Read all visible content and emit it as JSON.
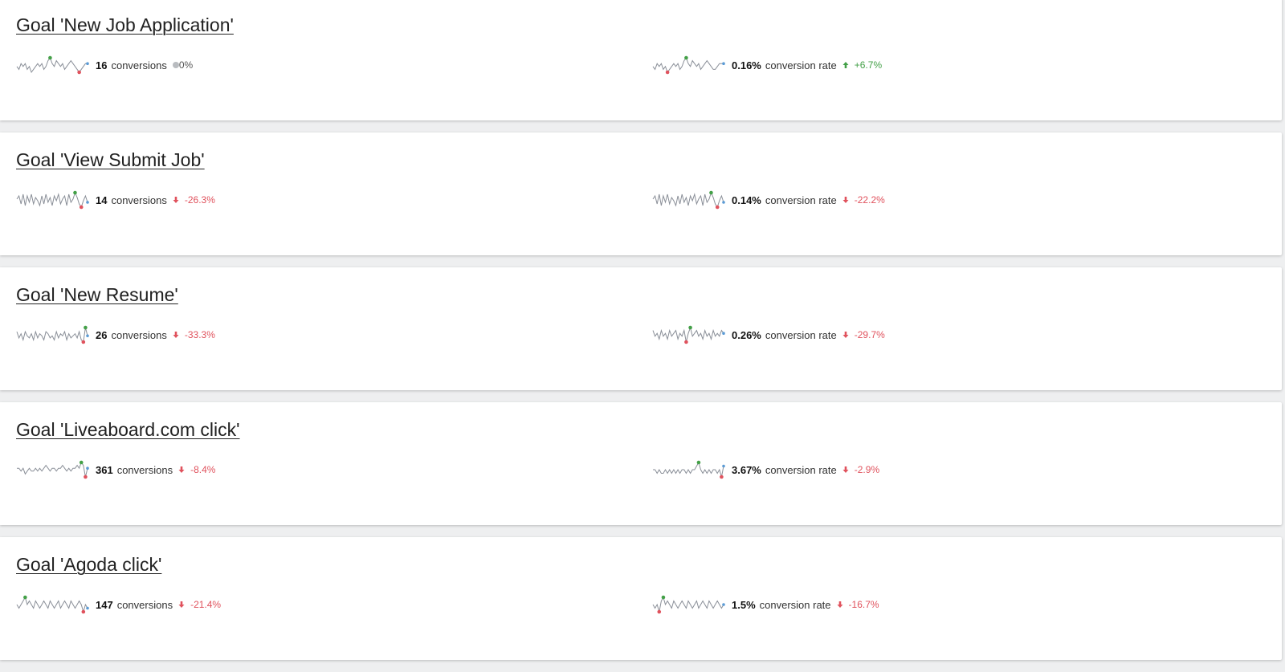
{
  "colors": {
    "up": "#43a047",
    "down": "#e0525d",
    "neutral": "#b9bcc0",
    "sparkline": "#8a8f98",
    "spark_max": "#43a047",
    "spark_min": "#e0525d",
    "spark_last": "#5b9bd5"
  },
  "goals": [
    {
      "title": "Goal 'New Job Application'",
      "conversions": {
        "value": "16",
        "label": "conversions",
        "trend": "0%",
        "direction": "neutral",
        "sparkline": [
          5,
          4,
          6,
          5,
          6,
          4,
          5,
          3,
          4,
          5,
          6,
          5,
          6,
          4,
          5,
          7,
          8,
          6,
          5,
          7,
          6,
          5,
          6,
          4,
          5,
          6,
          7,
          6,
          5,
          4,
          3,
          4,
          5,
          6,
          6
        ]
      },
      "rate": {
        "value": "0.16%",
        "label": "conversion rate",
        "trend": "+6.7%",
        "direction": "up",
        "sparkline": [
          5,
          4,
          6,
          5,
          6,
          4,
          5,
          3,
          4,
          5,
          6,
          5,
          6,
          4,
          5,
          7,
          8,
          6,
          5,
          7,
          6,
          5,
          6,
          4,
          5,
          6,
          7,
          6,
          5,
          4,
          4,
          5,
          6,
          6,
          6
        ]
      }
    },
    {
      "title": "Goal 'View Submit Job'",
      "conversions": {
        "value": "14",
        "label": "conversions",
        "trend": "-26.3%",
        "direction": "down",
        "sparkline": [
          6,
          8,
          3,
          9,
          2,
          8,
          4,
          9,
          3,
          7,
          5,
          2,
          8,
          3,
          9,
          4,
          7,
          2,
          8,
          5,
          9,
          3,
          6,
          8,
          2,
          9,
          4,
          6,
          10,
          7,
          3,
          1,
          5,
          8,
          4
        ]
      },
      "rate": {
        "value": "0.14%",
        "label": "conversion rate",
        "trend": "-22.2%",
        "direction": "down",
        "sparkline": [
          6,
          8,
          3,
          9,
          2,
          8,
          4,
          9,
          3,
          7,
          5,
          2,
          8,
          3,
          9,
          4,
          7,
          2,
          8,
          5,
          9,
          3,
          6,
          8,
          2,
          9,
          4,
          6,
          10,
          7,
          3,
          1,
          5,
          8,
          4
        ]
      }
    },
    {
      "title": "Goal 'New Resume'",
      "conversions": {
        "value": "26",
        "label": "conversions",
        "trend": "-33.3%",
        "direction": "down",
        "sparkline": [
          7,
          4,
          6,
          3,
          7,
          5,
          4,
          6,
          3,
          7,
          4,
          6,
          5,
          3,
          7,
          6,
          4,
          5,
          3,
          7,
          4,
          6,
          5,
          7,
          3,
          6,
          4,
          5,
          6,
          4,
          7,
          3,
          2,
          9,
          5
        ]
      },
      "rate": {
        "value": "0.26%",
        "label": "conversion rate",
        "trend": "-29.7%",
        "direction": "down",
        "sparkline": [
          7,
          5,
          6,
          4,
          7,
          5,
          6,
          4,
          7,
          5,
          6,
          7,
          4,
          6,
          5,
          7,
          3,
          6,
          8,
          5,
          6,
          7,
          5,
          6,
          4,
          7,
          5,
          6,
          4,
          7,
          5,
          6,
          5,
          7,
          6
        ]
      }
    },
    {
      "title": "Goal 'Liveaboard.com click'",
      "conversions": {
        "value": "361",
        "label": "conversions",
        "trend": "-8.4%",
        "direction": "down",
        "sparkline": [
          6,
          6,
          5,
          6,
          4,
          5,
          6,
          5,
          5,
          6,
          5,
          6,
          5,
          6,
          7,
          6,
          5,
          6,
          6,
          5,
          6,
          6,
          7,
          6,
          5,
          6,
          5,
          6,
          6,
          7,
          6,
          8,
          7,
          3,
          6
        ]
      },
      "rate": {
        "value": "3.67%",
        "label": "conversion rate",
        "trend": "-2.9%",
        "direction": "down",
        "sparkline": [
          6,
          6,
          5,
          6,
          5,
          5,
          6,
          5,
          6,
          5,
          6,
          5,
          6,
          5,
          6,
          6,
          5,
          6,
          5,
          6,
          6,
          7,
          8,
          6,
          5,
          6,
          5,
          6,
          5,
          6,
          6,
          5,
          6,
          4,
          7
        ]
      }
    },
    {
      "title": "Goal 'Agoda click'",
      "conversions": {
        "value": "147",
        "label": "conversions",
        "trend": "-21.4%",
        "direction": "down",
        "sparkline": [
          6,
          5,
          6,
          7,
          8,
          6,
          7,
          6,
          5,
          7,
          6,
          5,
          6,
          7,
          6,
          5,
          7,
          6,
          5,
          6,
          7,
          5,
          6,
          7,
          6,
          5,
          7,
          6,
          5,
          6,
          7,
          6,
          4,
          6,
          5
        ]
      },
      "rate": {
        "value": "1.5%",
        "label": "conversion rate",
        "trend": "-16.7%",
        "direction": "down",
        "sparkline": [
          6,
          5,
          6,
          4,
          7,
          8,
          6,
          7,
          6,
          5,
          7,
          6,
          5,
          6,
          7,
          6,
          5,
          7,
          6,
          5,
          6,
          7,
          5,
          6,
          7,
          6,
          5,
          7,
          6,
          5,
          6,
          7,
          6,
          5,
          6
        ]
      }
    }
  ]
}
